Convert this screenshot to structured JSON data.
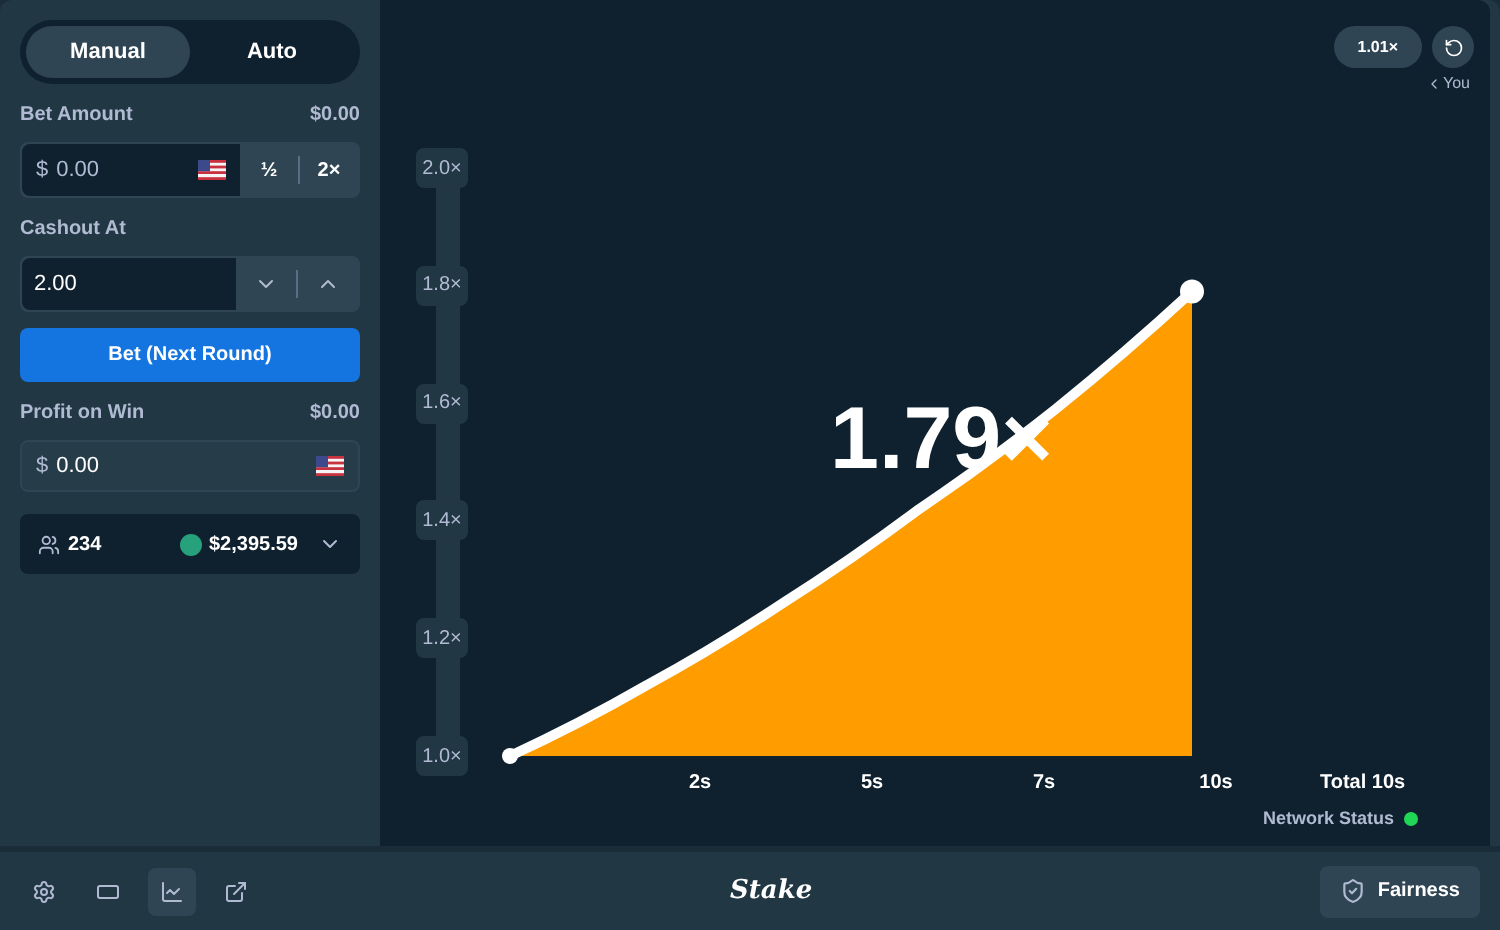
{
  "mode_tabs": [
    {
      "label": "Manual",
      "selected": true
    },
    {
      "label": "Auto",
      "selected": false
    }
  ],
  "bet_amount": {
    "label": "Bet Amount",
    "usd": "$0.00",
    "currency": "$",
    "value": "0.00",
    "half": "½",
    "double": "2×"
  },
  "cashout": {
    "label": "Cashout At",
    "value": "2.00"
  },
  "bet_button": "Bet (Next Round)",
  "profit": {
    "label": "Profit on Win",
    "usd": "$0.00",
    "currency": "$",
    "value": "0.00"
  },
  "players": {
    "count": "234",
    "total": "$2,395.59"
  },
  "history": {
    "last_multiplier": "1.01×",
    "you_label": "You"
  },
  "game": {
    "multiplier": "1.79×",
    "total": "Total 10s",
    "y_axis_labels": [
      "2.0×",
      "1.8×",
      "1.6×",
      "1.4×",
      "1.2×",
      "1.0×"
    ],
    "x_axis_labels": [
      "2s",
      "5s",
      "7s",
      "10s"
    ]
  },
  "network_status": {
    "label": "Network Status",
    "connected": true
  },
  "footer": {
    "tools": [
      {
        "kind": "settings",
        "selected": false
      },
      {
        "kind": "theatre",
        "selected": false
      },
      {
        "kind": "stats",
        "selected": true
      },
      {
        "kind": "popout",
        "selected": false
      }
    ],
    "logo": "Stake",
    "fairness": "Fairness"
  }
}
